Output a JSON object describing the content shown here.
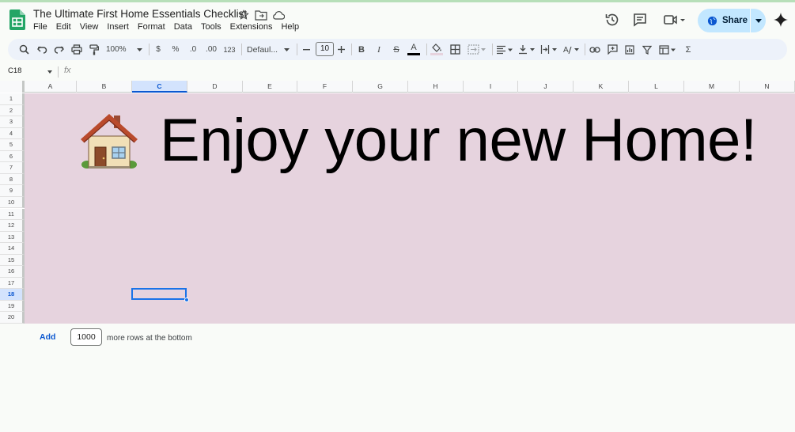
{
  "document": {
    "title": "The Ultimate First Home Essentials Checklist"
  },
  "menu": [
    "File",
    "Edit",
    "View",
    "Insert",
    "Format",
    "Data",
    "Tools",
    "Extensions",
    "Help"
  ],
  "header": {
    "share_label": "Share",
    "icons": [
      "history-icon",
      "comment-icon",
      "meet-icon",
      "gemini-icon"
    ]
  },
  "toolbar": {
    "zoom": "100%",
    "currency": "$",
    "percent": "%",
    "decrease_decimal": ".0",
    "increase_decimal": ".00",
    "number_format": "123",
    "font": "Defaul...",
    "font_size": "10",
    "sum": "Σ"
  },
  "formula_bar": {
    "name_box": "C18",
    "fx": "fx",
    "content": ""
  },
  "grid": {
    "columns": [
      "A",
      "B",
      "C",
      "D",
      "E",
      "F",
      "G",
      "H",
      "I",
      "J",
      "K",
      "L",
      "M",
      "N"
    ],
    "selected_column": "C",
    "rows": [
      "1",
      "2",
      "3",
      "4",
      "5",
      "6",
      "7",
      "8",
      "9",
      "10",
      "11",
      "12",
      "13",
      "14",
      "15",
      "16",
      "17",
      "18",
      "19",
      "20"
    ],
    "selected_row": "18",
    "background_color": "#e6d3de"
  },
  "banner": {
    "emoji": "🏠",
    "text": "Enjoy your new Home!"
  },
  "footer": {
    "add_label": "Add",
    "rows_value": "1000",
    "rows_suffix": "more rows at the bottom"
  },
  "colors": {
    "accent": "#0b57d0",
    "share_bg": "#c2e7ff",
    "sheets_green": "#23a566"
  }
}
